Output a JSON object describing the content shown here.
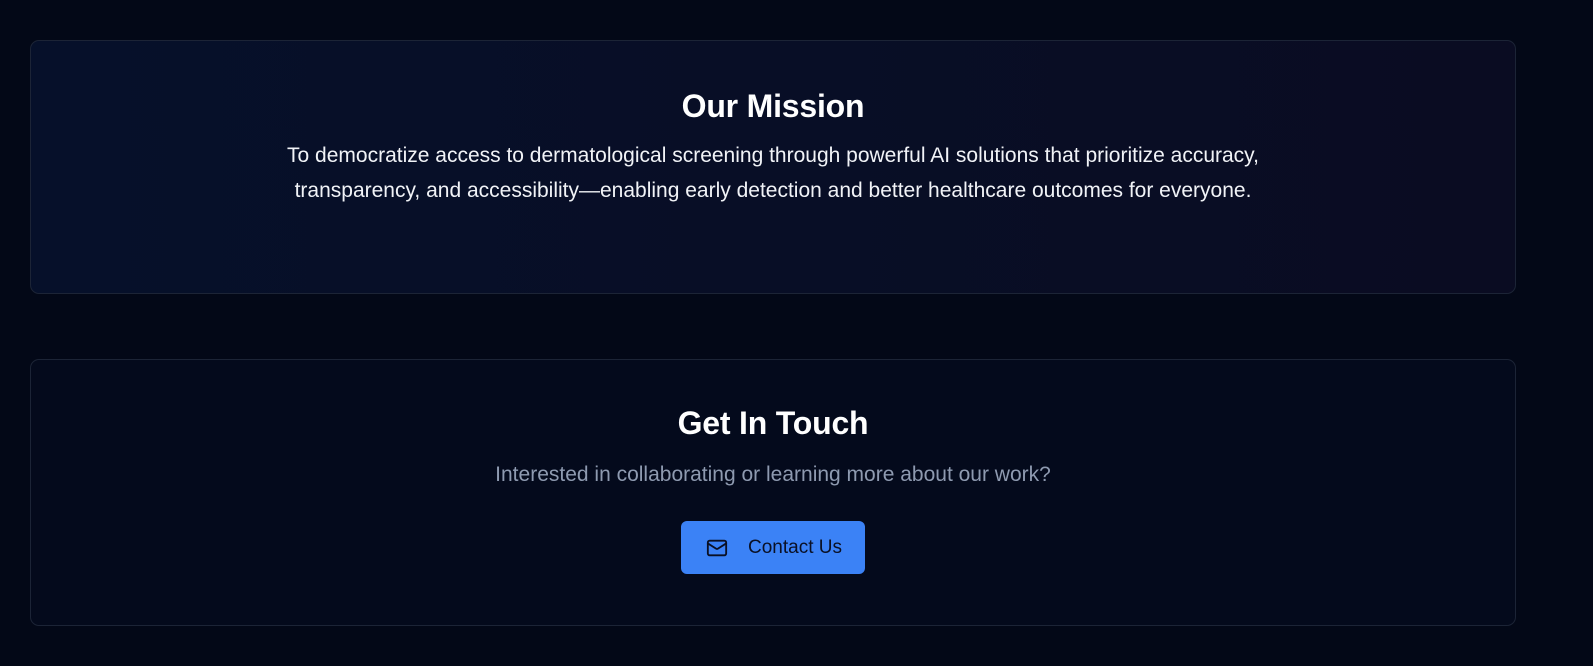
{
  "mission": {
    "title": "Our Mission",
    "text": "To democratize access to dermatological screening through powerful AI solutions that prioritize accuracy, transparency, and accessibility—enabling early detection and better healthcare outcomes for everyone."
  },
  "contact": {
    "title": "Get In Touch",
    "subtitle": "Interested in collaborating or learning more about our work?",
    "button_label": "Contact Us",
    "button_icon": "mail-icon"
  },
  "colors": {
    "background": "#030817",
    "accent": "#3b82f6",
    "muted_text": "#8e9ab0"
  }
}
